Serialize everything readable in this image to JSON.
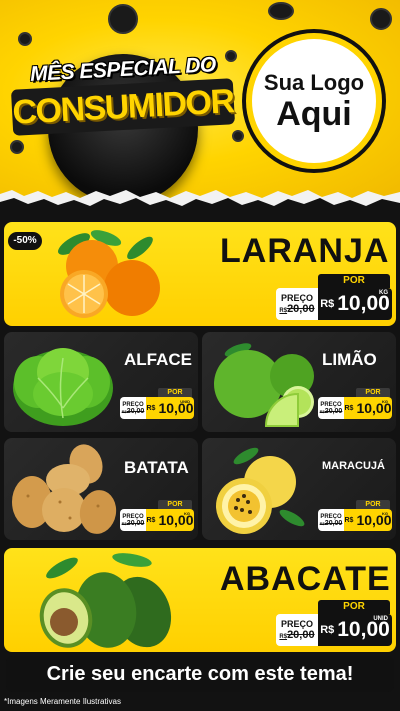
{
  "header": {
    "badge_line1": "MÊS ESPECIAL DO",
    "badge_line2": "CONSUMIDOR",
    "logo_line1": "Sua Logo",
    "logo_line2": "Aqui"
  },
  "products": [
    {
      "id": "laranja",
      "name": "LARANJA",
      "discount": "-50%",
      "por": "POR",
      "preco_label": "PREÇO",
      "old_prefix": "R$",
      "old": "20,00",
      "currency": "R$",
      "new": "10,00",
      "unit": "KG"
    },
    {
      "id": "alface",
      "name": "ALFACE",
      "por": "POR",
      "preco_label": "PREÇO",
      "old_prefix": "R$",
      "old": "20,00",
      "currency": "R$",
      "new": "10,00",
      "unit": "UNID"
    },
    {
      "id": "limao",
      "name": "LIMÃO",
      "por": "POR",
      "preco_label": "PREÇO",
      "old_prefix": "R$",
      "old": "20,00",
      "currency": "R$",
      "new": "10,00",
      "unit": "KG"
    },
    {
      "id": "batata",
      "name": "BATATA",
      "por": "POR",
      "preco_label": "PREÇO",
      "old_prefix": "R$",
      "old": "20,00",
      "currency": "R$",
      "new": "10,00",
      "unit": "KG"
    },
    {
      "id": "maracuja",
      "name": "MARACUJÁ",
      "por": "POR",
      "preco_label": "PREÇO",
      "old_prefix": "R$",
      "old": "20,00",
      "currency": "R$",
      "new": "10,00",
      "unit": "KG"
    },
    {
      "id": "abacate",
      "name": "ABACATE",
      "por": "POR",
      "preco_label": "PREÇO",
      "old_prefix": "R$",
      "old": "20,00",
      "currency": "R$",
      "new": "10,00",
      "unit": "UNID"
    }
  ],
  "cta": "Crie seu encarte com este tema!",
  "footer_note": "*Imagens Meramente Ilustrativas",
  "colors": {
    "yellow": "#ffd400",
    "dark": "#1a1a1a",
    "black": "#111111"
  }
}
